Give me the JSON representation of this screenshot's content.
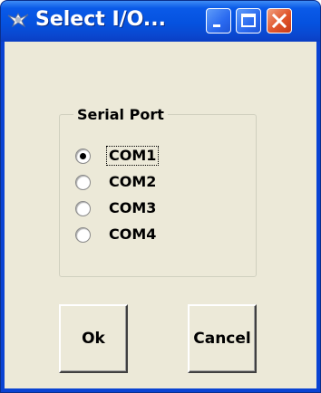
{
  "window": {
    "title": "Select I/O...",
    "app_icon": "grasshopper-icon",
    "controls": {
      "minimize_icon": "minimize-icon",
      "maximize_icon": "maximize-icon",
      "close_icon": "close-icon"
    },
    "colors": {
      "titlebar": "#0552df",
      "client": "#ece9d8",
      "close_button": "#e0552b"
    }
  },
  "serial_port": {
    "label": "Serial Port",
    "selected": "COM1",
    "options": [
      {
        "label": "COM1",
        "checked": true
      },
      {
        "label": "COM2",
        "checked": false
      },
      {
        "label": "COM3",
        "checked": false
      },
      {
        "label": "COM4",
        "checked": false
      }
    ]
  },
  "buttons": {
    "ok_label": "Ok",
    "cancel_label": "Cancel"
  }
}
